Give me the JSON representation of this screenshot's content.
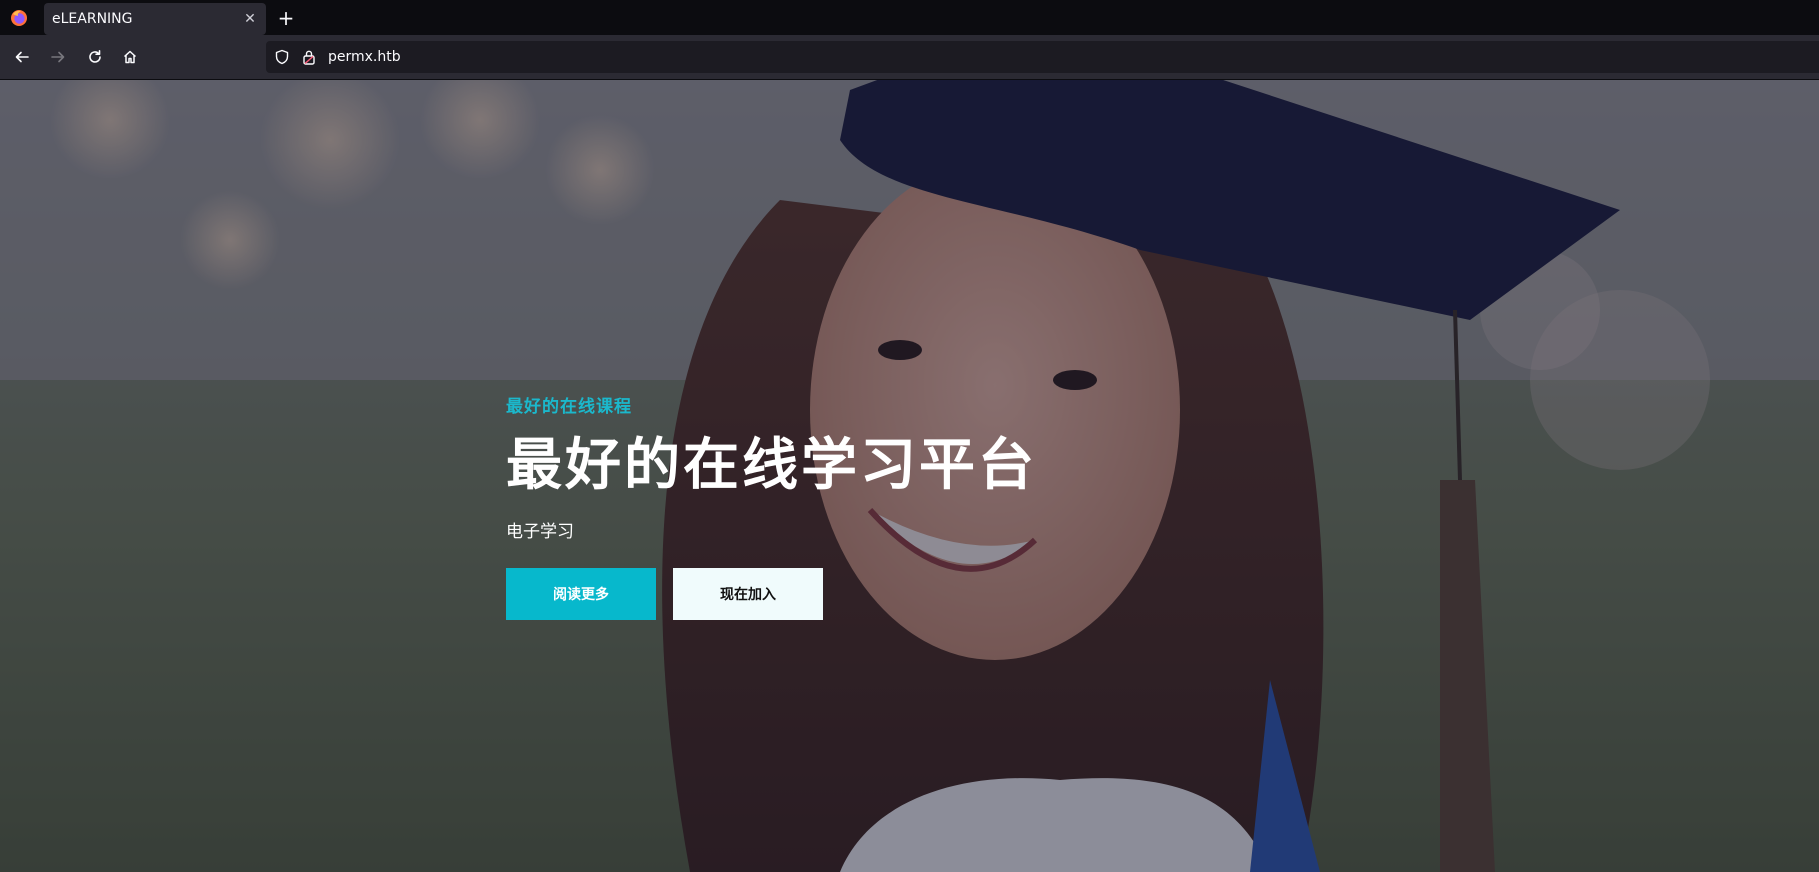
{
  "browser": {
    "tab_title": "eLEARNING",
    "tab_close_icon": "close-icon",
    "new_tab_icon": "plus-icon",
    "url": "permx.htb",
    "nav_icons": [
      "back-arrow-icon",
      "forward-arrow-icon",
      "reload-icon",
      "home-icon"
    ],
    "urlbar_icons": [
      "shield-icon",
      "lock-icon"
    ]
  },
  "hero": {
    "subtitle": "最好的在线课程",
    "title": "最好的在线学习平台",
    "description": "电子学习",
    "buttons": {
      "read_more": "阅读更多",
      "join_now": "现在加入"
    }
  },
  "colors": {
    "accent": "#07b8cc",
    "overlay": "#141630"
  }
}
